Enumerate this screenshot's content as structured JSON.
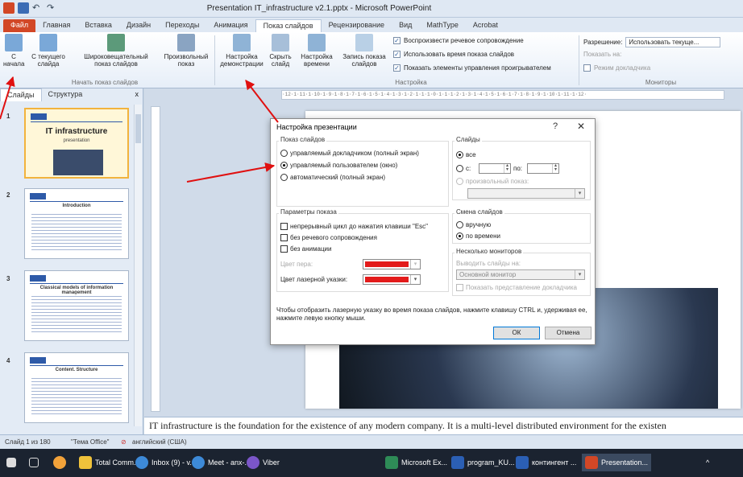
{
  "window": {
    "title": "Presentation IT_infrastructure v2.1.pptx  -  Microsoft PowerPoint"
  },
  "ribbon_tabs": [
    "Файл",
    "Главная",
    "Вставка",
    "Дизайн",
    "Переходы",
    "Анимация",
    "Показ слайдов",
    "Рецензирование",
    "Вид",
    "MathType",
    "Acrobat"
  ],
  "ribbon": {
    "from_start": "С\nначала",
    "from_current": "С текущего\nслайда",
    "broadcast": "Широковещательный\nпоказ слайдов",
    "custom_show": "Произвольный\nпоказ",
    "group_start": "Начать показ слайдов",
    "setup_show": "Настройка\nдемонстрации",
    "hide_slide": "Скрыть\nслайд",
    "rehearse": "Настройка\nвремени",
    "record": "Запись показа\nслайдов",
    "chk_narration": "Воспроизвести речевое сопровождение",
    "chk_timings": "Использовать время показа слайдов",
    "chk_controls": "Показать элементы управления проигрывателем",
    "group_setup": "Настройка",
    "resolution_label": "Разрешение:",
    "resolution_value": "Использовать текуще...",
    "show_on_label": "Показать на:",
    "presenter_view": "Режим докладчика",
    "group_monitors": "Мониторы"
  },
  "left_pane": {
    "tab_slides": "Слайды",
    "tab_outline": "Структура",
    "close": "x",
    "thumbs": [
      {
        "num": "1",
        "title": "IT infrastructure",
        "subtitle": "presentation"
      },
      {
        "num": "2",
        "title": "Introduction"
      },
      {
        "num": "3",
        "title": "Classical models of information management"
      },
      {
        "num": "4",
        "title": "Content. Structure"
      }
    ]
  },
  "slide": {
    "title_fragment": "rastructure",
    "big_fragment": "ure"
  },
  "notes_text": "IT infrastructure is the foundation for the existence of any modern company. It is a multi-level distributed environment for the existen",
  "status": {
    "slide_of": "Слайд 1 из 180",
    "theme": "\"Тема Office\"",
    "language": "английский (США)"
  },
  "taskbar": {
    "items": [
      "Total Comm...",
      "Inbox (9) - v...",
      "Meet - anx-...",
      "Viber",
      "Microsoft Ex...",
      "program_KU...",
      "контингент ...",
      "Presentation..."
    ]
  },
  "dialog": {
    "title": "Настройка презентации",
    "help": "?",
    "close": "✕",
    "show_type": {
      "legend": "Показ слайдов",
      "opt_presenter": "управляемый докладчиком (полный экран)",
      "opt_individual": "управляемый пользователем (окно)",
      "opt_kiosk": "автоматический (полный экран)",
      "selected": "управляемый пользователем (окно)"
    },
    "show_options": {
      "legend": "Параметры показа",
      "loop": "непрерывный цикл до нажатия клавиши \"Esc\"",
      "no_narration": "без речевого сопровождения",
      "no_animation": "без анимации",
      "pen_color": "Цвет пера:",
      "laser_color": "Цвет лазерной указки:",
      "pen_color_value": "#e31b1b",
      "laser_color_value": "#e31b1b"
    },
    "slides": {
      "legend": "Слайды",
      "opt_all": "все",
      "opt_from": "с:",
      "to": "по:",
      "custom_show": "произвольный показ:"
    },
    "advance": {
      "legend": "Смена слайдов",
      "opt_manual": "вручную",
      "opt_timings": "по времени"
    },
    "monitors": {
      "legend": "Несколько мониторов",
      "show_on": "Выводить слайды на:",
      "monitor_value": "Основной монитор",
      "presenter_view": "Показать представление докладчика"
    },
    "note": "Чтобы отобразить лазерную указку во время показа слайдов, нажмите клавишу CTRL и, удерживая ее, нажмите левую кнопку мыши.",
    "ok": "ОК",
    "cancel": "Отмена"
  }
}
